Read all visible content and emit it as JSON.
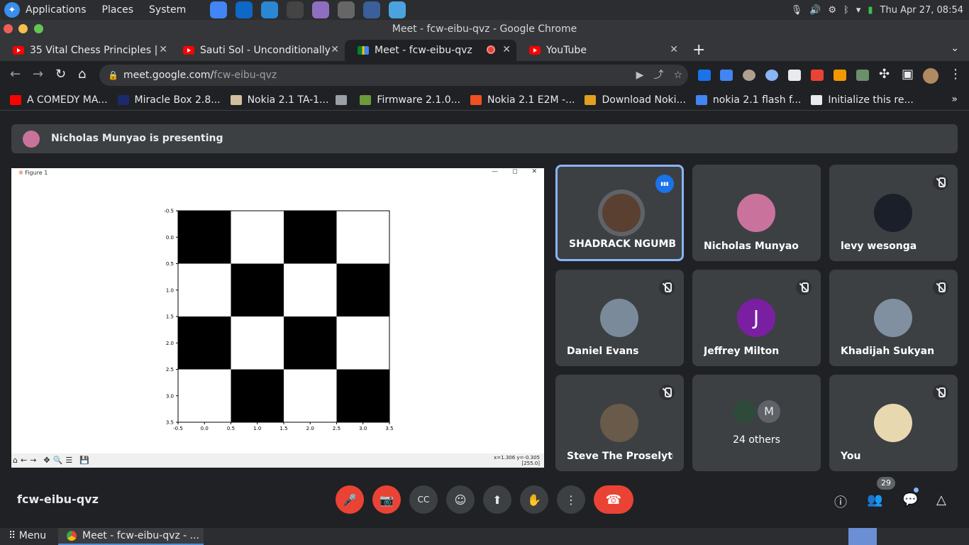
{
  "desktop": {
    "menu": [
      "Applications",
      "Places",
      "System"
    ],
    "launchers": [
      {
        "icon": "chrome-icon",
        "color": "#4285f4"
      },
      {
        "icon": "teamviewer-icon",
        "color": "#0e68c8"
      },
      {
        "icon": "app-icon",
        "color": "#2b87d1"
      },
      {
        "icon": "terminal-icon",
        "color": "#444444"
      },
      {
        "icon": "notes-icon",
        "color": "#8e6fbf"
      },
      {
        "icon": "camera-icon",
        "color": "#666666"
      },
      {
        "icon": "monitor-icon",
        "color": "#3a5f9a"
      },
      {
        "icon": "settings-app-icon",
        "color": "#4aa3df"
      }
    ],
    "clock": "Thu Apr 27, 08:54"
  },
  "window": {
    "title": "Meet - fcw-eibu-qvz - Google Chrome"
  },
  "tabs": [
    {
      "title": "35 Vital Chess Principles |",
      "icon": "youtube-icon"
    },
    {
      "title": "Sauti Sol - Unconditionally",
      "icon": "youtube-icon"
    },
    {
      "title": "Meet - fcw-eibu-qvz",
      "icon": "meet-icon"
    },
    {
      "title": "YouTube",
      "icon": "youtube-icon"
    }
  ],
  "address": {
    "host": "meet.google.com/",
    "path": "fcw-eibu-qvz"
  },
  "bookmarks": [
    {
      "label": "A COMEDY MA...",
      "color": "#ff0000"
    },
    {
      "label": "Miracle Box 2.8...",
      "color": "#1a2a6c"
    },
    {
      "label": "Nokia 2.1 TA-1...",
      "color": "#d0c0a0"
    },
    {
      "label": "",
      "color": "#9aa0a6"
    },
    {
      "label": "Firmware 2.1.0...",
      "color": "#6a9a3a"
    },
    {
      "label": "Nokia 2.1 E2M -...",
      "color": "#f25022"
    },
    {
      "label": "Download Noki...",
      "color": "#e0a020"
    },
    {
      "label": "nokia 2.1 flash f...",
      "color": "#4285f4"
    },
    {
      "label": "Initialize this re...",
      "color": "#e8eaed"
    }
  ],
  "meeting": {
    "presenting_banner": "Nicholas Munyao is presenting",
    "code": "fcw-eibu-qvz",
    "participant_count": "29"
  },
  "figure": {
    "window_title": "Figure 1",
    "coords_readout": "x=1.306 y=-0.305",
    "coords_value": "[255.0]"
  },
  "chart_data": {
    "type": "heatmap",
    "title": "",
    "rows": 4,
    "cols": 4,
    "values": [
      [
        0,
        255,
        0,
        255
      ],
      [
        255,
        0,
        255,
        0
      ],
      [
        0,
        255,
        0,
        255
      ],
      [
        255,
        0,
        255,
        0
      ]
    ],
    "xlim": [
      -0.5,
      3.5
    ],
    "ylim": [
      3.5,
      -0.5
    ],
    "x_ticks": [
      "-0.5",
      "0.0",
      "0.5",
      "1.0",
      "1.5",
      "2.0",
      "2.5",
      "3.0",
      "3.5"
    ],
    "y_ticks": [
      "-0.5",
      "0.0",
      "0.5",
      "1.0",
      "1.5",
      "2.0",
      "2.5",
      "3.0",
      "3.5"
    ],
    "colormap": "gray"
  },
  "participants": [
    {
      "name": "SHADRACK NGUMB...",
      "speaking": true,
      "muted": false,
      "avatar_color": "#5a4030"
    },
    {
      "name": "Nicholas Munyao",
      "speaking": false,
      "muted": false,
      "avatar_color": "#c9739c"
    },
    {
      "name": "levy wesonga",
      "speaking": false,
      "muted": true,
      "avatar_color": "#1a1f2a"
    },
    {
      "name": "Daniel Evans",
      "speaking": false,
      "muted": true,
      "avatar_color": "#7a8a9a"
    },
    {
      "name": "Jeffrey Milton",
      "speaking": false,
      "muted": true,
      "avatar_color": "#7b1fa2",
      "initial": "J"
    },
    {
      "name": "Khadijah Sukyan",
      "speaking": false,
      "muted": true,
      "avatar_color": "#8090a0"
    },
    {
      "name": "Steve The Proselyte",
      "speaking": false,
      "muted": true,
      "avatar_color": "#6a5a4a"
    },
    {
      "name": "24 others",
      "speaking": false,
      "muted": false,
      "avatar_color": "#5f6368",
      "initial": "M"
    },
    {
      "name": "You",
      "speaking": false,
      "muted": true,
      "avatar_color": "#e8d8b0"
    }
  ],
  "taskbar": {
    "menu_label": "Menu",
    "task_label": "Meet - fcw-eibu-qvz - ..."
  }
}
